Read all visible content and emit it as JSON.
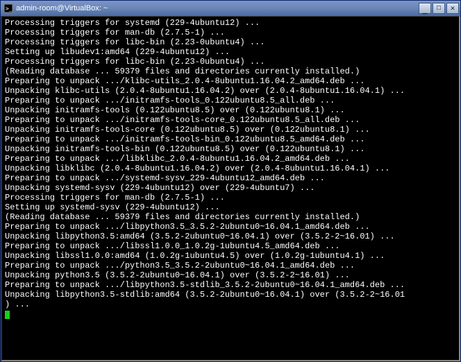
{
  "window": {
    "title": "admin-room@VirtualBox: ~",
    "icon_name": "terminal-icon"
  },
  "terminal": {
    "lines": [
      "Processing triggers for systemd (229-4ubuntu12) ...",
      "Processing triggers for man-db (2.7.5-1) ...",
      "Processing triggers for libc-bin (2.23-0ubuntu4) ...",
      "Setting up libudev1:amd64 (229-4ubuntu12) ...",
      "Processing triggers for libc-bin (2.23-0ubuntu4) ...",
      "(Reading database ... 59379 files and directories currently installed.)",
      "Preparing to unpack .../klibc-utils_2.0.4-8ubuntu1.16.04.2_amd64.deb ...",
      "Unpacking klibc-utils (2.0.4-8ubuntu1.16.04.2) over (2.0.4-8ubuntu1.16.04.1) ...",
      "Preparing to unpack .../initramfs-tools_0.122ubuntu8.5_all.deb ...",
      "Unpacking initramfs-tools (0.122ubuntu8.5) over (0.122ubuntu8.1) ...",
      "Preparing to unpack .../initramfs-tools-core_0.122ubuntu8.5_all.deb ...",
      "Unpacking initramfs-tools-core (0.122ubuntu8.5) over (0.122ubuntu8.1) ...",
      "Preparing to unpack .../initramfs-tools-bin_0.122ubuntu8.5_amd64.deb ...",
      "Unpacking initramfs-tools-bin (0.122ubuntu8.5) over (0.122ubuntu8.1) ...",
      "Preparing to unpack .../libklibc_2.0.4-8ubuntu1.16.04.2_amd64.deb ...",
      "Unpacking libklibc (2.0.4-8ubuntu1.16.04.2) over (2.0.4-8ubuntu1.16.04.1) ...",
      "Preparing to unpack .../systemd-sysv_229-4ubuntu12_amd64.deb ...",
      "Unpacking systemd-sysv (229-4ubuntu12) over (229-4ubuntu7) ...",
      "Processing triggers for man-db (2.7.5-1) ...",
      "Setting up systemd-sysv (229-4ubuntu12) ...",
      "(Reading database ... 59379 files and directories currently installed.)",
      "Preparing to unpack .../libpython3.5_3.5.2-2ubuntu0~16.04.1_amd64.deb ...",
      "Unpacking libpython3.5:amd64 (3.5.2-2ubuntu0~16.04.1) over (3.5.2-2~16.01) ...",
      "Preparing to unpack .../libssl1.0.0_1.0.2g-1ubuntu4.5_amd64.deb ...",
      "Unpacking libssl1.0.0:amd64 (1.0.2g-1ubuntu4.5) over (1.0.2g-1ubuntu4.1) ...",
      "Preparing to unpack .../python3.5_3.5.2-2ubuntu0~16.04.1_amd64.deb ...",
      "Unpacking python3.5 (3.5.2-2ubuntu0~16.04.1) over (3.5.2-2~16.01) ...",
      "Preparing to unpack .../libpython3.5-stdlib_3.5.2-2ubuntu0~16.04.1_amd64.deb ...",
      "Unpacking libpython3.5-stdlib:amd64 (3.5.2-2ubuntu0~16.04.1) over (3.5.2-2~16.01",
      ") ..."
    ]
  }
}
